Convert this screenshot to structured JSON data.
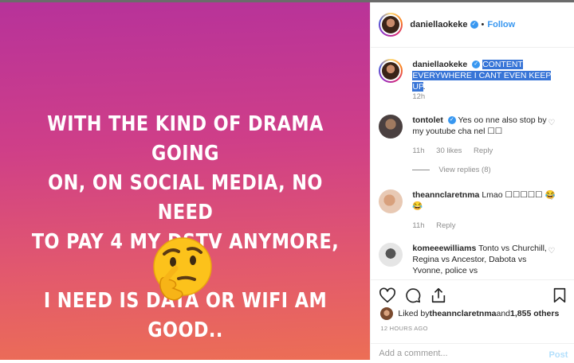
{
  "media": {
    "text_lines": [
      "WITH THE KIND OF DRAMA GOING",
      "ON, ON SOCIAL MEDIA, NO NEED",
      "TO PAY 4 MY DSTV ANYMORE, ALL",
      "I NEED IS DATA OR WIFI AM GOOD.."
    ],
    "emoji": "thinking-face"
  },
  "header": {
    "username": "daniellaokeke",
    "verified_glyph": "✓",
    "separator": "•",
    "follow_label": "Follow"
  },
  "caption": {
    "username": "daniellaokeke",
    "text": "CONTENT EVERYWHERE I CANT EVEN KEEP UP",
    "text_tail": ".",
    "age": "12h"
  },
  "comments": [
    {
      "username": "tontolet",
      "text": "Yes oo nne also stop by my youtube cha nel ☐☐",
      "age": "11h",
      "likes": "30 likes",
      "reply": "Reply",
      "view_replies": "View replies (8)"
    },
    {
      "username": "theannclaretnma",
      "text": "Lmao ☐☐☐☐☐ 😂😂",
      "age": "11h",
      "reply": "Reply"
    },
    {
      "username": "komeeewilliams",
      "text": "Tonto vs Churchill, Regina vs Ancestor, Dabota vs Yvonne, police vs"
    }
  ],
  "likes": {
    "prefix": "Liked by ",
    "user": "theannclaretnma",
    "middle": " and ",
    "count": "1,855 others"
  },
  "timestamp": "12 HOURS AGO",
  "add_comment": {
    "placeholder": "Add a comment...",
    "post_label": "Post"
  },
  "colors": {
    "gradient_top": "#b7329a",
    "gradient_bottom": "#ec6e55",
    "link_blue": "#3897f0",
    "highlight": "#3875d7"
  }
}
